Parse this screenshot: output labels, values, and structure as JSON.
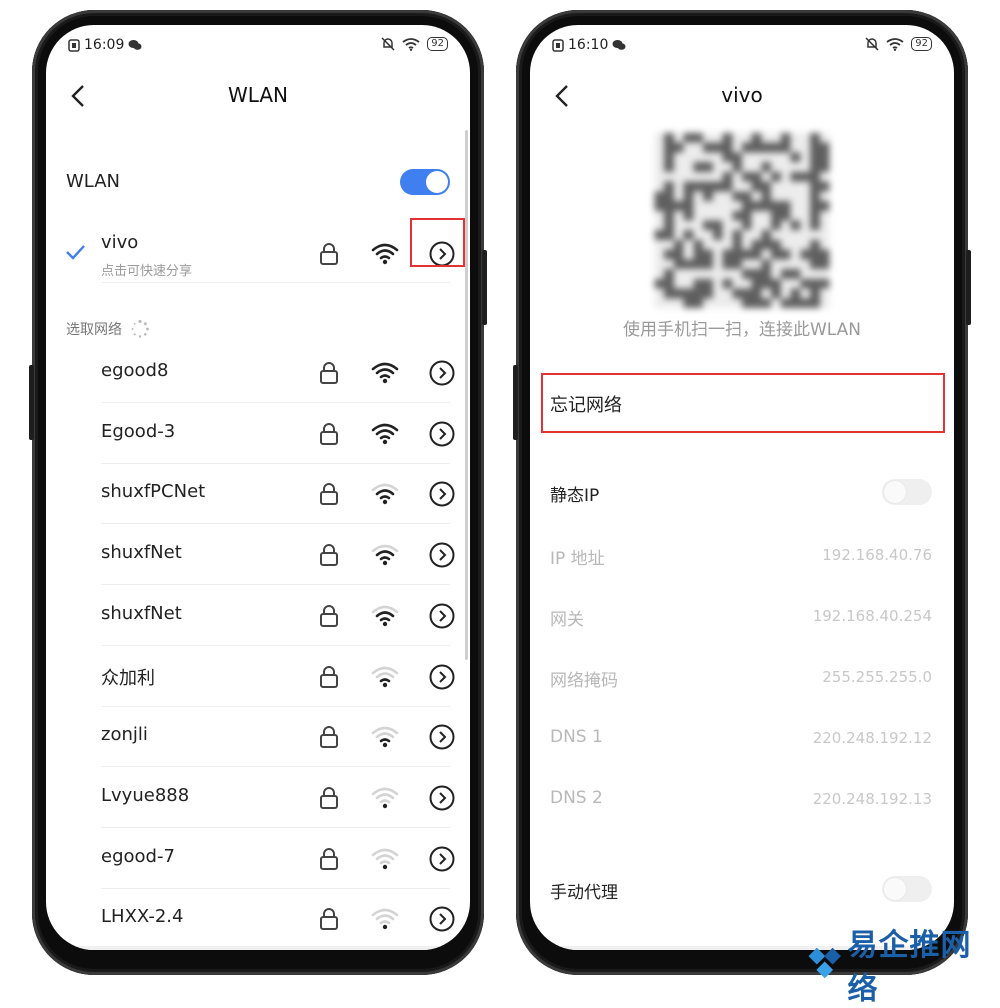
{
  "left_screen": {
    "status": {
      "time": "16:09",
      "battery": "92"
    },
    "title": "WLAN",
    "wlan_label": "WLAN",
    "wlan_enabled": true,
    "connected": {
      "name": "vivo",
      "subtitle": "点击可快速分享",
      "wifi_strength": 4
    },
    "section_label": "选取网络",
    "networks": [
      {
        "name": "egood8",
        "wifi_strength": 4
      },
      {
        "name": "Egood-3",
        "wifi_strength": 4
      },
      {
        "name": "shuxfPCNet",
        "wifi_strength": 3
      },
      {
        "name": "shuxfNet",
        "wifi_strength": 3
      },
      {
        "name": "shuxfNet",
        "wifi_strength": 3
      },
      {
        "name": "众加利",
        "wifi_strength": 2
      },
      {
        "name": "zonjli",
        "wifi_strength": 2
      },
      {
        "name": "Lvyue888",
        "wifi_strength": 1
      },
      {
        "name": "egood-7",
        "wifi_strength": 1
      },
      {
        "name": "LHXX-2.4",
        "wifi_strength": 1
      }
    ]
  },
  "right_screen": {
    "status": {
      "time": "16:10",
      "battery": "92"
    },
    "title": "vivo",
    "qr_caption": "使用手机扫一扫，连接此WLAN",
    "forget_label": "忘记网络",
    "static_ip_label": "静态IP",
    "static_ip_enabled": false,
    "details": [
      {
        "key": "IP 地址",
        "value": "192.168.40.76"
      },
      {
        "key": "网关",
        "value": "192.168.40.254"
      },
      {
        "key": "网络掩码",
        "value": "255.255.255.0"
      },
      {
        "key": "DNS 1",
        "value": "220.248.192.12"
      },
      {
        "key": "DNS 2",
        "value": "220.248.192.13"
      }
    ],
    "proxy_label": "手动代理",
    "proxy_enabled": false
  },
  "watermark": {
    "text": "易企推网络"
  },
  "colors": {
    "accent": "#3f7ff0",
    "highlight": "#e23232",
    "watermark": "#1a5fa8"
  }
}
